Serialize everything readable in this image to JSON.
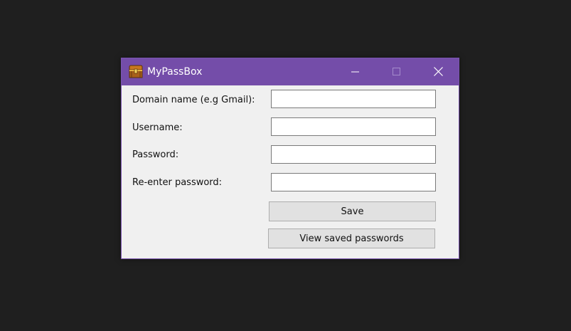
{
  "window": {
    "title": "MyPassBox",
    "titlebar_color": "#744da9",
    "app_icon": "treasure-chest-icon",
    "controls": {
      "minimize_icon": "minimize-icon",
      "maximize_icon": "maximize-icon",
      "close_icon": "close-icon"
    }
  },
  "form": {
    "domain_label": "Domain name (e.g Gmail):",
    "domain_value": "",
    "username_label": "Username:",
    "username_value": "",
    "password_label": "Password:",
    "password_value": "",
    "reenter_label": "Re-enter password:",
    "reenter_value": ""
  },
  "buttons": {
    "save_label": "Save",
    "view_label": "View saved passwords"
  }
}
